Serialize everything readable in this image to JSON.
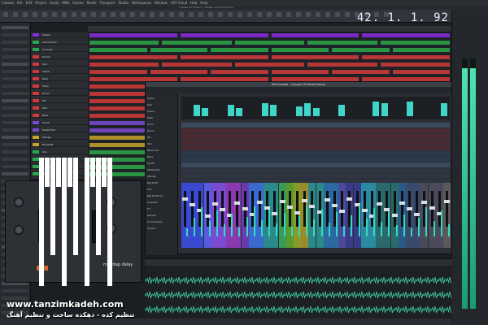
{
  "menu": [
    "Cubase",
    "File",
    "Edit",
    "Project",
    "Audio",
    "MIDI",
    "Scores",
    "Media",
    "Transport",
    "Studio",
    "Workspaces",
    "Window",
    "VST Cloud",
    "Hub",
    "Help"
  ],
  "window_title": "Cubase Pro Project - Cubase 10 Sound Demo",
  "transport": {
    "position": "42. 1. 1. 92"
  },
  "tracks": [
    {
      "name": "Tempo",
      "color": "#8a2be2"
    },
    {
      "name": "Chord Track",
      "color": "#2aa84a"
    },
    {
      "name": "Arranger",
      "color": "#2aa84a"
    },
    {
      "name": "Drums",
      "color": "#d23a3a"
    },
    {
      "name": "Kick",
      "color": "#d23a3a"
    },
    {
      "name": "Snare",
      "color": "#d23a3a"
    },
    {
      "name": "Hats",
      "color": "#d23a3a"
    },
    {
      "name": "Toms",
      "color": "#d23a3a"
    },
    {
      "name": "Room",
      "color": "#d23a3a"
    },
    {
      "name": "OH",
      "color": "#d23a3a"
    },
    {
      "name": "Perc",
      "color": "#d23a3a"
    },
    {
      "name": "Bass",
      "color": "#d23a3a"
    },
    {
      "name": "Synth",
      "color": "#7a4ad0"
    },
    {
      "name": "Muted Pad",
      "color": "#7a4ad0"
    },
    {
      "name": "Strings",
      "color": "#c8a22a"
    },
    {
      "name": "Big Stuff",
      "color": "#c8a22a"
    },
    {
      "name": "Vox",
      "color": "#2aa84a"
    },
    {
      "name": "Big Stuff Vox",
      "color": "#2aa84a"
    },
    {
      "name": "Ambient",
      "color": "#2aa84a"
    },
    {
      "name": "FX",
      "color": "#2aa84a"
    }
  ],
  "mixer": {
    "title": "MixConsole - Cubase 10 Sound Demo",
    "rack_items": [
      "Audio",
      "Kick",
      "Snare",
      "Hats",
      "Toms",
      "Room",
      "OH",
      "Perc",
      "Bass Sub",
      "Bass",
      "Synth",
      "Muted Pad",
      "Strings",
      "Big Stuff",
      "Vox",
      "Big Stuff Vox",
      "Ambient",
      "FX",
      "Groups",
      "FX Channels",
      "Output"
    ]
  },
  "plugin": {
    "name": "multitap delay"
  },
  "watermark": {
    "url": "www.tanzimkadeh.com",
    "tagline": "تنظیم کده - دهکده ساخت و تنظیم آهنگ"
  },
  "colors": {
    "accent": "#3fd5c8",
    "meter": "#4fe3b2"
  }
}
